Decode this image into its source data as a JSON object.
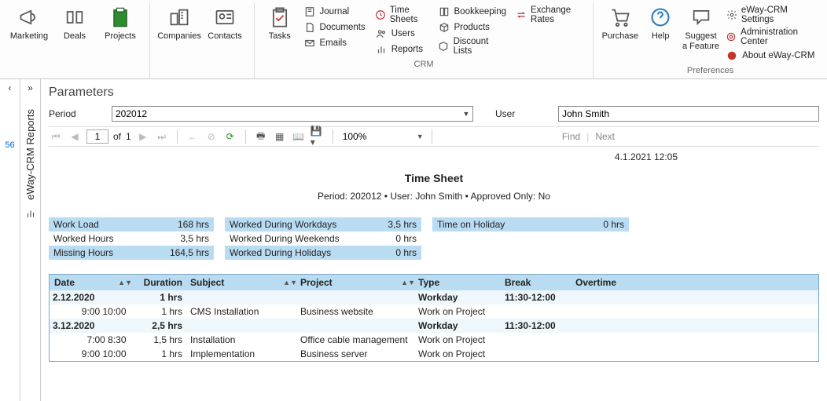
{
  "ribbon": {
    "marketing": "Marketing",
    "deals": "Deals",
    "projects": "Projects",
    "companies": "Companies",
    "contacts": "Contacts",
    "tasks": "Tasks",
    "journal": "Journal",
    "documents": "Documents",
    "emails": "Emails",
    "timesheets": "Time Sheets",
    "users": "Users",
    "reports": "Reports",
    "bookkeeping": "Bookkeeping",
    "products": "Products",
    "discountlists": "Discount Lists",
    "exchangerates": "Exchange Rates",
    "crm_group": "CRM",
    "purchase": "Purchase",
    "help": "Help",
    "suggest": "Suggest\na Feature",
    "eway_settings": "eWay-CRM Settings",
    "admin_center": "Administration Center",
    "about": "About eWay-CRM",
    "prefs_group": "Preferences"
  },
  "sidebar": {
    "number": "56",
    "tab_label": "eWay-CRM Reports"
  },
  "params": {
    "title": "Parameters",
    "period_label": "Period",
    "period_value": "202012",
    "user_label": "User",
    "user_value": "John Smith"
  },
  "pager": {
    "current": "1",
    "of": "of",
    "total": "1",
    "zoom": "100%",
    "find": "Find",
    "next": "Next"
  },
  "report": {
    "timestamp": "4.1.2021 12:05",
    "title": "Time Sheet",
    "subtitle": "Period: 202012  •  User: John Smith  •  Approved Only: No",
    "summary_a": [
      {
        "label": "Work Load",
        "value": "168 hrs",
        "hl": true
      },
      {
        "label": "Worked Hours",
        "value": "3,5 hrs",
        "hl": false
      },
      {
        "label": "Missing Hours",
        "value": "164,5 hrs",
        "hl": true
      }
    ],
    "summary_b": [
      {
        "label": "Worked During Workdays",
        "value": "3,5 hrs",
        "hl": true
      },
      {
        "label": "Worked During Weekends",
        "value": "0 hrs",
        "hl": false
      },
      {
        "label": "Worked During Holidays",
        "value": "0 hrs",
        "hl": true
      }
    ],
    "summary_c": [
      {
        "label": "Time on Holiday",
        "value": "0 hrs",
        "hl": true
      }
    ],
    "headers": {
      "date": "Date",
      "duration": "Duration",
      "subject": "Subject",
      "project": "Project",
      "type": "Type",
      "break": "Break",
      "overtime": "Overtime"
    },
    "groups": [
      {
        "date": "2.12.2020",
        "duration": "1 hrs",
        "type": "Workday",
        "break": "11:30-12:00",
        "rows": [
          {
            "time": "9:00  10:00",
            "duration": "1 hrs",
            "subject": "CMS Installation",
            "project": "Business website",
            "type": "Work on Project"
          }
        ]
      },
      {
        "date": "3.12.2020",
        "duration": "2,5 hrs",
        "type": "Workday",
        "break": "11:30-12:00",
        "rows": [
          {
            "time": "7:00  8:30",
            "duration": "1,5 hrs",
            "subject": "Installation",
            "project": "Office cable management",
            "type": "Work on Project"
          },
          {
            "time": "9:00  10:00",
            "duration": "1 hrs",
            "subject": "Implementation",
            "project": "Business server",
            "type": "Work on Project"
          }
        ]
      }
    ]
  }
}
